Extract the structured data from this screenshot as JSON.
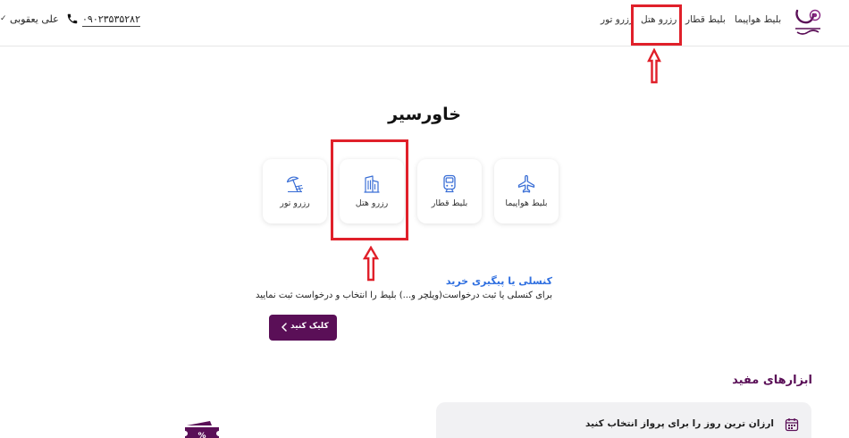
{
  "header": {
    "nav": {
      "flight": "بلیط هواپیما",
      "train": "بلیط قطار",
      "hotel": "رزرو هتل",
      "tour": "رزرو تور"
    },
    "phone": "۰۹۰۲۳۵۳۵۲۸۲",
    "user_name": "علی یعقوبی",
    "logo_text": "خاورسیر"
  },
  "main": {
    "title": "خاورسیر",
    "services": [
      {
        "label": "بلیط هواپیما",
        "icon": "airplane-icon"
      },
      {
        "label": "بلیط قطار",
        "icon": "train-icon"
      },
      {
        "label": "رزرو هتل",
        "icon": "hotel-building-icon"
      },
      {
        "label": "رزرو تور",
        "icon": "beach-umbrella-icon"
      }
    ],
    "refund": {
      "title": "کنسلی یا پیگیری خرید",
      "description": "برای کنسلی یا ثبت درخواست(ویلچر و...) بلیط را انتخاب و درخواست ثبت نمایید",
      "button": "کلیک کنید"
    },
    "tools": {
      "title": "ابزارهای مفید",
      "item": "ارزان ترین روز را برای پرواز انتخاب کنید"
    }
  },
  "colors": {
    "brand": "#5a0f57",
    "link": "#2f6fe0",
    "icon": "#3b6fd6",
    "annotation": "#e0202a"
  }
}
